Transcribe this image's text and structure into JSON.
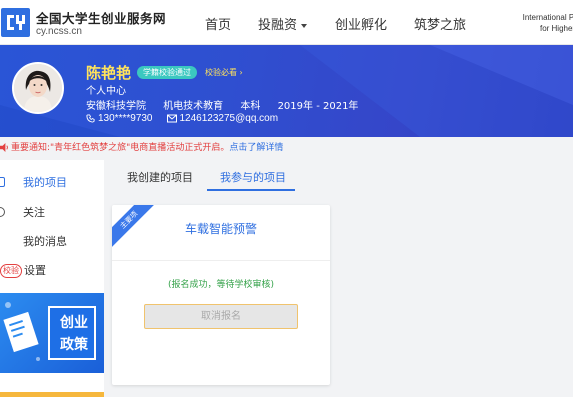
{
  "site": {
    "logo_icon": "cy-logo-icon",
    "name": "全国大学生创业服务网",
    "url": "cy.ncss.cn",
    "brand_color": "#2f6fe0"
  },
  "nav": {
    "items": [
      {
        "label": "首页"
      },
      {
        "label": "投融资",
        "has_dropdown": true
      },
      {
        "label": "创业孵化"
      },
      {
        "label": "筑梦之旅"
      }
    ],
    "intl_line1": "International Participa",
    "intl_line2": "for Higher Educa"
  },
  "profile": {
    "name": "陈艳艳",
    "verify_badge": "学籍校验通过",
    "must_check": "校验必看",
    "subtitle": "个人中心",
    "school": "安徽科技学院",
    "major": "机电技术教育",
    "degree": "本科",
    "years": "2019年 - 2021年",
    "phone": "130****9730",
    "email": "1246123275@qq.com"
  },
  "notice": {
    "text": "重要通知:\"青年红色筑梦之旅\"电商直播活动正式开启。",
    "link": "点击了解详情"
  },
  "sidebar": {
    "items": [
      {
        "label": "我的项目",
        "active": true
      },
      {
        "label": "关注"
      },
      {
        "label": "我的消息"
      },
      {
        "label": "设置",
        "prefix": "校验"
      }
    ],
    "promo_line1": "创业",
    "promo_line2": "政策"
  },
  "tabs": [
    {
      "label": "我创建的项目"
    },
    {
      "label": "我参与的项目",
      "active": true
    }
  ],
  "project_card": {
    "corner_label": "主要项",
    "title": "车载智能预警",
    "status": "(报名成功，等待学校审核)",
    "cancel_label": "取消报名"
  }
}
